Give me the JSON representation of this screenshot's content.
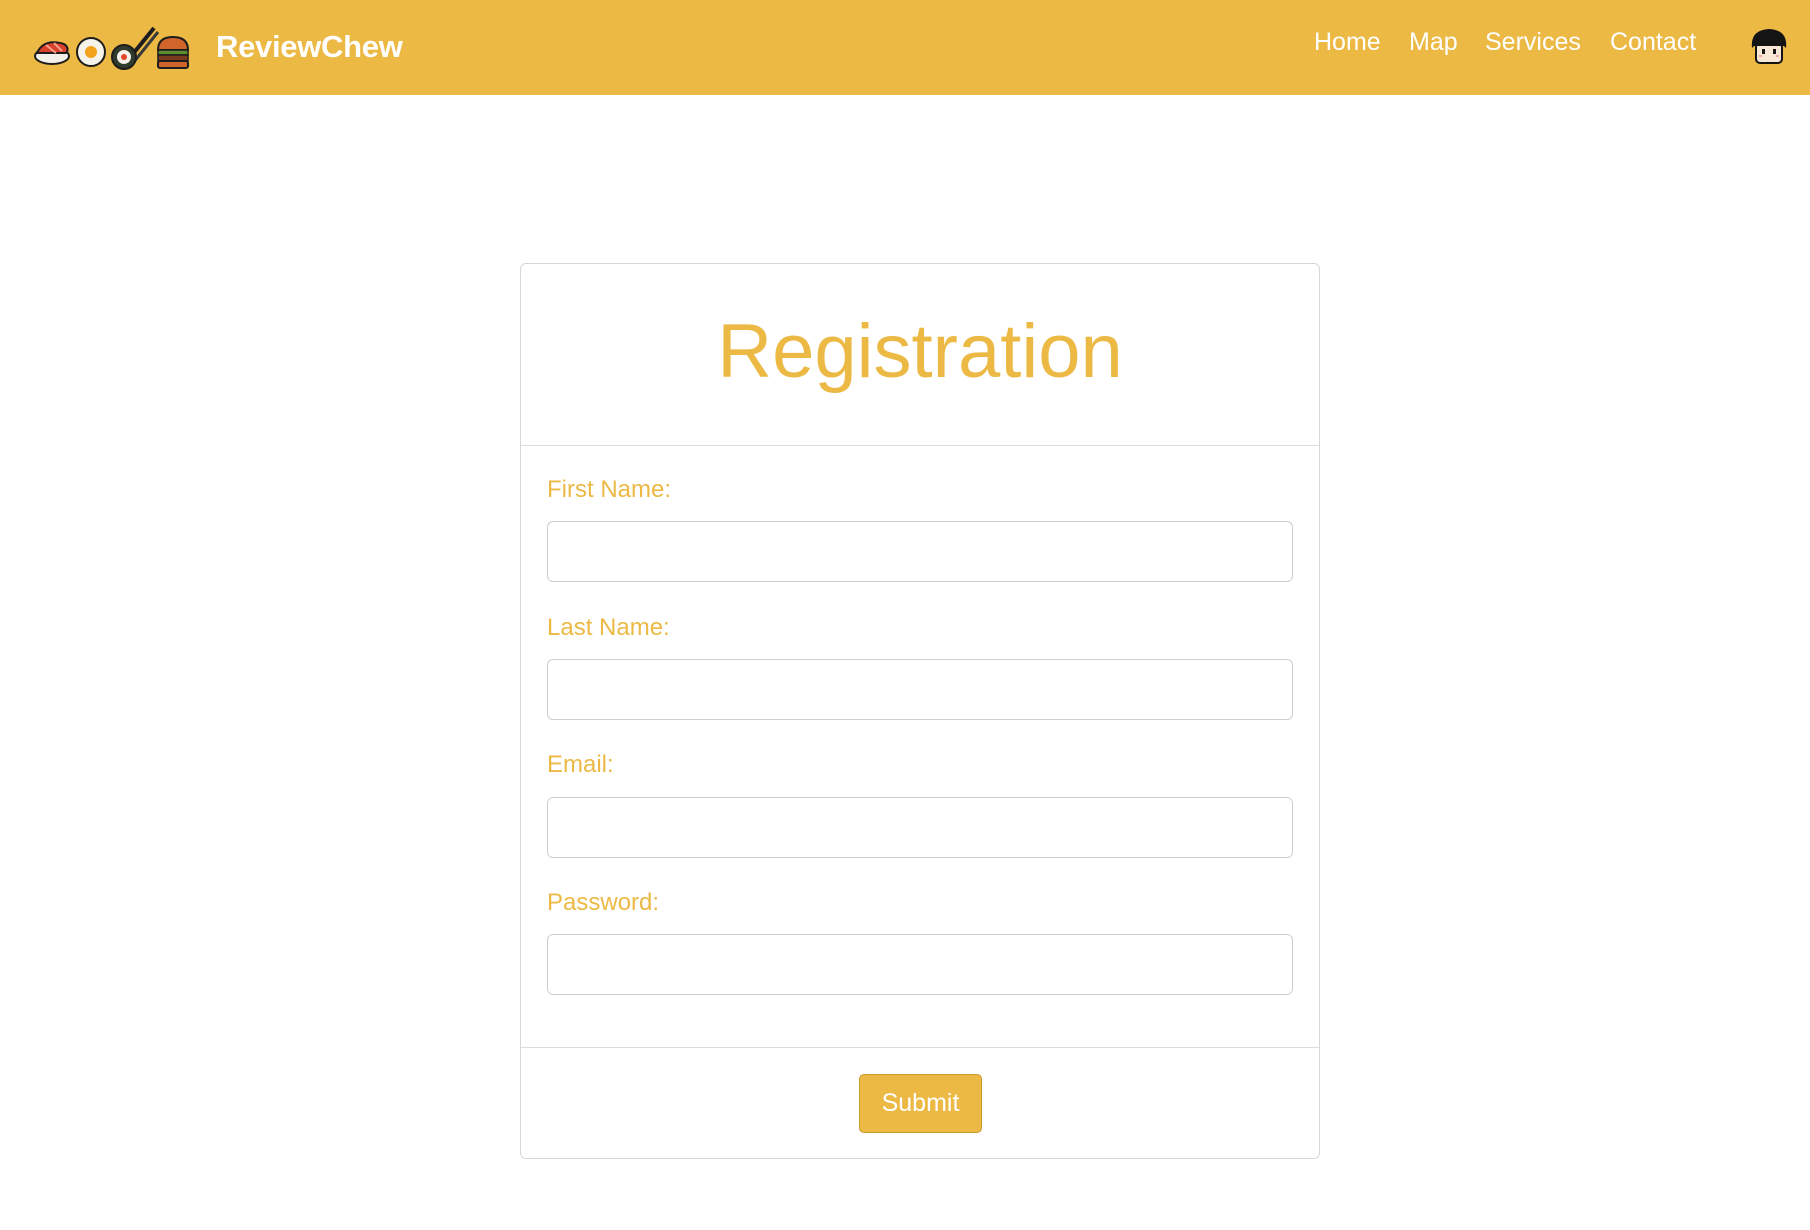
{
  "navbar": {
    "brand": "ReviewChew",
    "links": [
      "Home",
      "Map",
      "Services",
      "Contact"
    ],
    "logo_icons": [
      "sushi-icon",
      "egg-icon",
      "sushi-roll-chopsticks-icon",
      "burger-icon"
    ],
    "avatar_icon": "user-avatar-icon",
    "background_color": "#ecb945"
  },
  "form": {
    "title": "Registration",
    "fields": [
      {
        "label": "First Name:",
        "value": ""
      },
      {
        "label": "Last Name:",
        "value": ""
      },
      {
        "label": "Email:",
        "value": ""
      },
      {
        "label": "Password:",
        "value": ""
      }
    ],
    "submit_label": "Submit",
    "accent_color": "#ecb945"
  }
}
